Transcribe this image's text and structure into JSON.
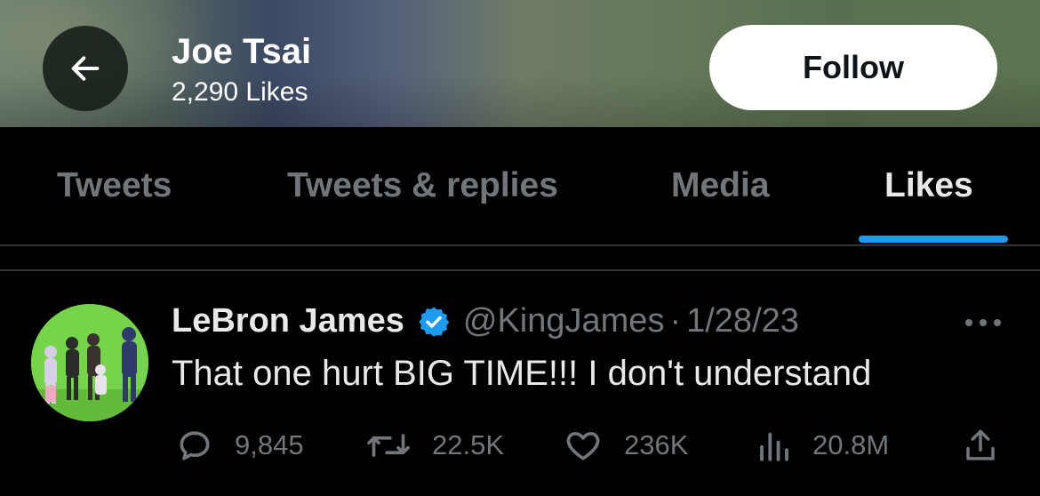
{
  "header": {
    "title": "Joe Tsai",
    "subtitle": "2,290 Likes",
    "follow_label": "Follow"
  },
  "tabs": [
    {
      "label": "Tweets",
      "active": false
    },
    {
      "label": "Tweets & replies",
      "active": false
    },
    {
      "label": "Media",
      "active": false
    },
    {
      "label": "Likes",
      "active": true
    }
  ],
  "tweet": {
    "author_name": "LeBron James",
    "handle": "@KingJames",
    "separator": "·",
    "date": "1/28/23",
    "text": "That one hurt BIG TIME!!! I don't understand",
    "actions": {
      "replies": "9,845",
      "retweets": "22.5K",
      "likes": "236K",
      "views": "20.8M"
    },
    "verified": true
  },
  "colors": {
    "accent": "#1d9bf0",
    "muted_text": "#71767b",
    "background": "#000000",
    "avatar_bg": "#76d44a"
  },
  "icons": [
    "arrow-left-icon",
    "verified-badge-icon",
    "more-icon",
    "reply-icon",
    "retweet-icon",
    "like-icon",
    "views-icon",
    "share-icon"
  ]
}
